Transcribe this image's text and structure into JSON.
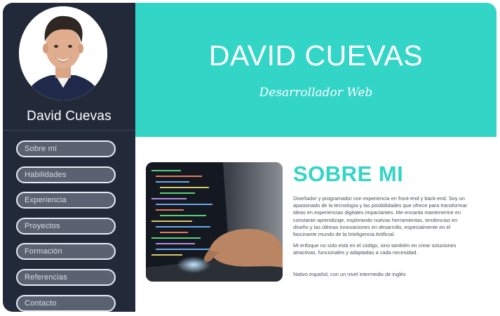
{
  "sidebar": {
    "name": "David Cuevas",
    "nav": [
      {
        "label": "Sobre mí"
      },
      {
        "label": "Habilidades"
      },
      {
        "label": "Experiencia"
      },
      {
        "label": "Proyectos"
      },
      {
        "label": "Formación"
      },
      {
        "label": "Referencias"
      },
      {
        "label": "Contacto"
      }
    ]
  },
  "header": {
    "title": "DAVID CUEVAS",
    "subtitle": "Desarrollador Web"
  },
  "about": {
    "title": "SOBRE MI",
    "paragraphs": [
      "Diseñador y programador con experiencia en front-end y back-end. Soy un apasionado de la tecnología y las posibilidades que ofrece para transformar ideas en experiencias digitales impactantes. Me encanta mantenerme en constante aprendizaje, explorando nuevas herramientas, tendencias en diseño y las últimas innovaciones en desarrollo, especialmente en el fascinante mundo de la Inteligencia Artificial.",
      "Mi enfoque no solo está en el código, sino también en crear soluciones atractivas, funcionales y adaptadas a cada necesidad.",
      "Nativo español, con un nivel intermedio de inglés"
    ]
  },
  "colors": {
    "accent": "#33d5c7",
    "sidebar_bg": "#222a3a",
    "nav_button_bg": "#5a6272"
  },
  "icons": {
    "avatar": "profile-photo",
    "about_image": "laptop-coding-photo"
  }
}
